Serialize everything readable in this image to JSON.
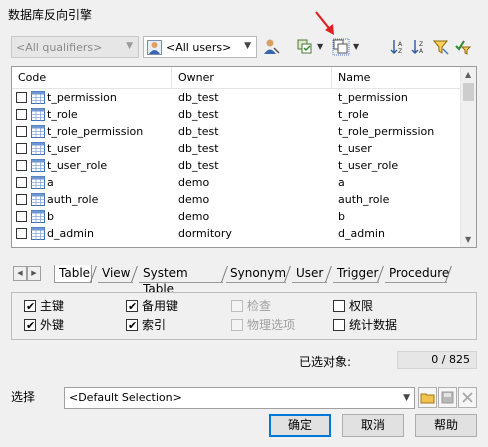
{
  "window": {
    "title": "数据库反向引擎"
  },
  "toolbar": {
    "qualifiers_value": "<All qualifiers>",
    "users_value": "<All users>"
  },
  "grid": {
    "columns": [
      "Code",
      "Owner",
      "Name"
    ],
    "rows": [
      {
        "code": "t_permission",
        "owner": "db_test",
        "name": "t_permission"
      },
      {
        "code": "t_role",
        "owner": "db_test",
        "name": "t_role"
      },
      {
        "code": "t_role_permission",
        "owner": "db_test",
        "name": "t_role_permission"
      },
      {
        "code": "t_user",
        "owner": "db_test",
        "name": "t_user"
      },
      {
        "code": "t_user_role",
        "owner": "db_test",
        "name": "t_user_role"
      },
      {
        "code": "a",
        "owner": "demo",
        "name": "a"
      },
      {
        "code": "auth_role",
        "owner": "demo",
        "name": "auth_role"
      },
      {
        "code": "b",
        "owner": "demo",
        "name": "b"
      },
      {
        "code": "d_admin",
        "owner": "dormitory",
        "name": "d_admin"
      }
    ]
  },
  "tabs": [
    "Table",
    "View",
    "System Table",
    "Synonym",
    "User",
    "Trigger",
    "Procedure"
  ],
  "options": {
    "primary_key": "主键",
    "alternate_key": "备用键",
    "check": "检查",
    "permission": "权限",
    "foreign_key": "外键",
    "index": "索引",
    "physical_options": "物理选项",
    "statistics": "统计数据"
  },
  "selection": {
    "selected_label": "已选对象:",
    "selected_count": "0 / 825",
    "label": "选择",
    "value": "<Default Selection>"
  },
  "buttons": {
    "ok": "确定",
    "cancel": "取消",
    "help": "帮助"
  },
  "colors": {
    "accent": "#0078d7",
    "annotation_arrow": "#e02020"
  }
}
